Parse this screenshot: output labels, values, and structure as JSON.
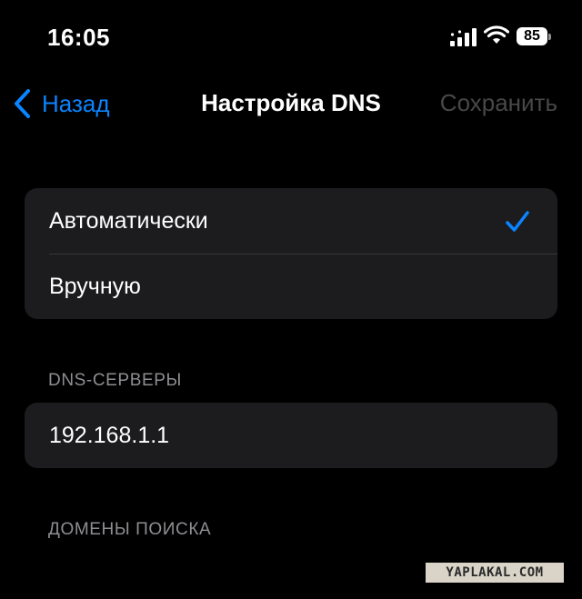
{
  "status_bar": {
    "time": "16:05",
    "battery_level": "85",
    "icons": [
      "cell-signal-icon",
      "wifi-icon",
      "battery-icon"
    ]
  },
  "nav": {
    "back_label": "Назад",
    "title": "Настройка DNS",
    "save_label": "Сохранить"
  },
  "dns_mode": {
    "options": [
      {
        "label": "Автоматически",
        "selected": true
      },
      {
        "label": "Вручную",
        "selected": false
      }
    ]
  },
  "dns_servers": {
    "header": "DNS-СЕРВЕРЫ",
    "servers": [
      "192.168.1.1"
    ]
  },
  "search_domains": {
    "header": "ДОМЕНЫ ПОИСКА"
  },
  "watermark": "YAPLAKAL.COM",
  "colors": {
    "background": "#000000",
    "group_background": "#1c1c1e",
    "accent": "#0a84ff",
    "disabled_text": "#48484a",
    "section_header": "#8e8e93",
    "separator": "#38383a"
  }
}
